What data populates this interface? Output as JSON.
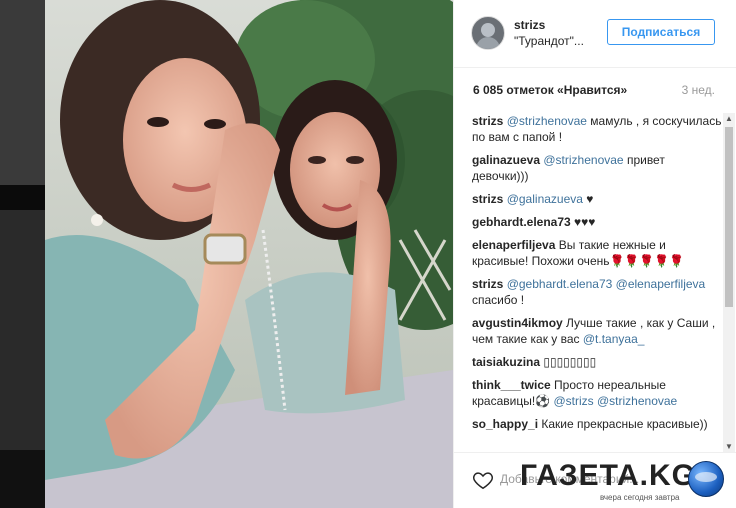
{
  "post": {
    "username": "strizs",
    "location": "\"Турандот\"...",
    "follow_label": "Подписаться",
    "likes": "6 085 отметок «Нравится»",
    "time_ago": "3 нед.",
    "add_comment_placeholder": "Добавьте комментарий..."
  },
  "comments": [
    {
      "user": "strizs",
      "parts": [
        {
          "t": "@strizhenovae",
          "m": true
        },
        {
          "t": " мамуль , я соскучилась по вам с папой !",
          "m": false
        }
      ]
    },
    {
      "user": "galinazueva",
      "parts": [
        {
          "t": "@strizhenovae",
          "m": true
        },
        {
          "t": " привет девочки)))",
          "m": false
        }
      ]
    },
    {
      "user": "strizs",
      "parts": [
        {
          "t": "@galinazueva",
          "m": true
        },
        {
          "t": " ♥",
          "m": false
        }
      ]
    },
    {
      "user": "gebhardt.elena73",
      "parts": [
        {
          "t": "♥♥♥",
          "m": false
        }
      ]
    },
    {
      "user": "elenaperfiljeva",
      "parts": [
        {
          "t": "Вы такие нежные и красивые! Похожи очень🌹🌹🌹🌹🌹",
          "m": false
        }
      ]
    },
    {
      "user": "strizs",
      "parts": [
        {
          "t": "@gebhardt.elena73",
          "m": true
        },
        {
          "t": " ",
          "m": false
        },
        {
          "t": "@elenaperfiljeva",
          "m": true
        },
        {
          "t": " спасибо !",
          "m": false
        }
      ]
    },
    {
      "user": "avgustin4ikmoy",
      "parts": [
        {
          "t": "Лучше такие , как у Саши , чем такие как у вас ",
          "m": false
        },
        {
          "t": "@t.tanyaa_",
          "m": true
        }
      ]
    },
    {
      "user": "taisiakuzina",
      "parts": [
        {
          "t": "▯▯▯▯▯▯▯▯",
          "m": false
        }
      ]
    },
    {
      "user": "think___twice",
      "parts": [
        {
          "t": "Просто нереальные красавицы!⚽ ",
          "m": false
        },
        {
          "t": "@strizs",
          "m": true
        },
        {
          "t": " ",
          "m": false
        },
        {
          "t": "@strizhenovae",
          "m": true
        }
      ]
    },
    {
      "user": "so_happy_i",
      "parts": [
        {
          "t": "Какие прекрасные красивые))",
          "m": false
        }
      ]
    }
  ],
  "watermark": {
    "title": "ГАЗЕТА.KG",
    "tagline": "вчера сегодня завтра"
  },
  "colors": {
    "link": "#3f729b",
    "follow": "#3897f0"
  }
}
